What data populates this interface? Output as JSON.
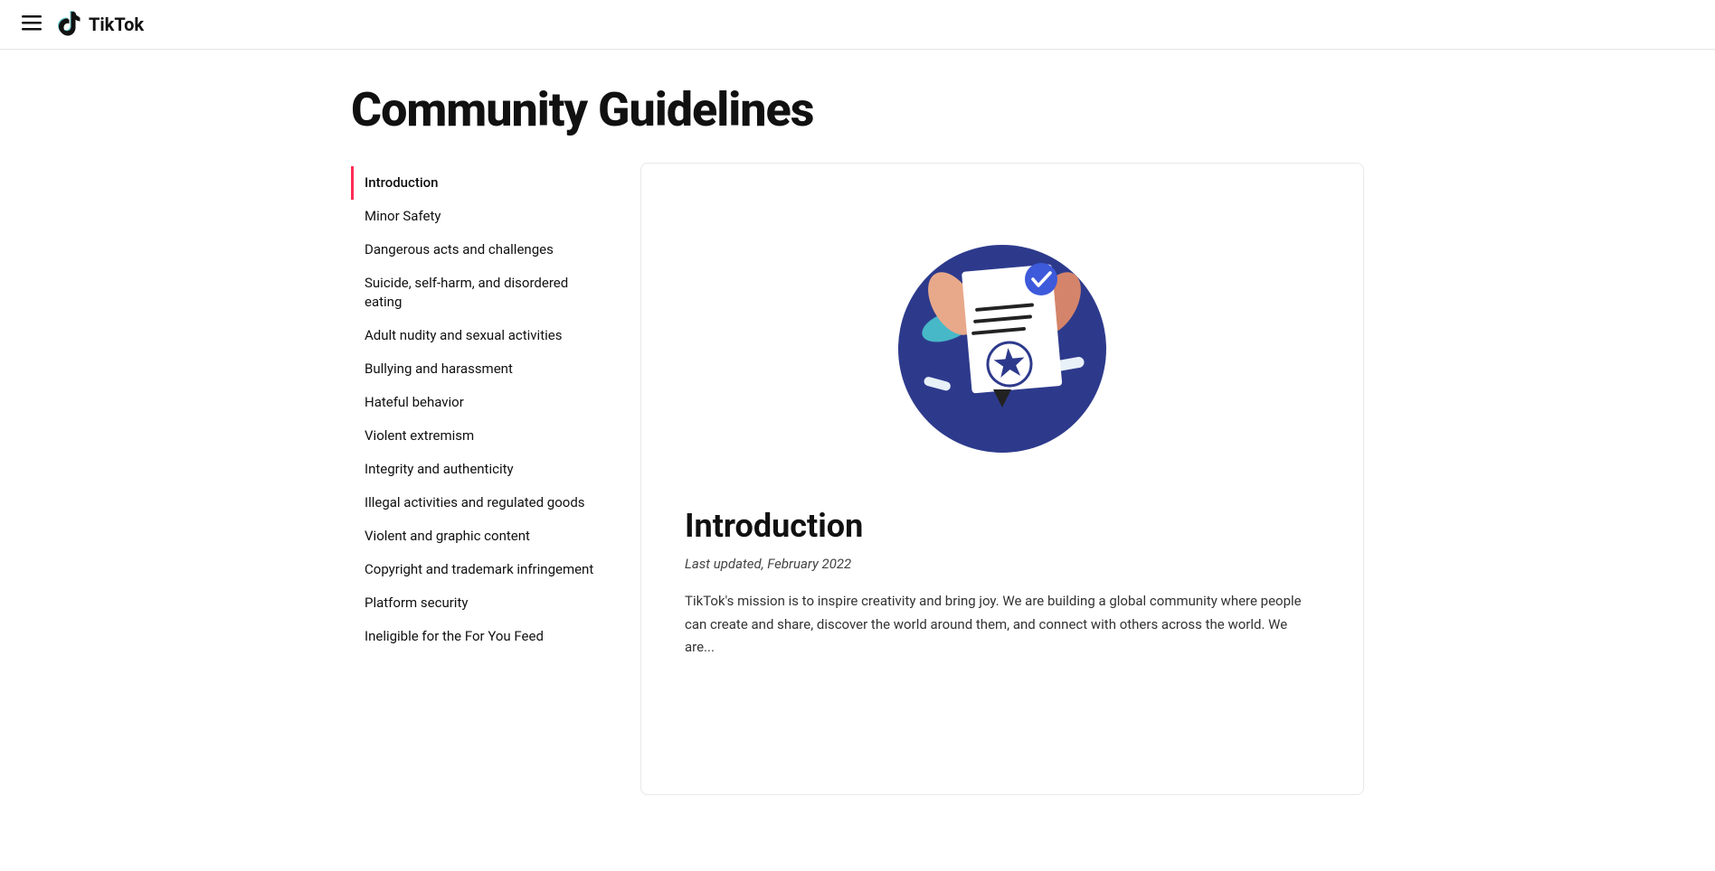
{
  "header": {
    "logo_text": "TikTok",
    "menu_icon": "≡"
  },
  "page": {
    "title": "Community Guidelines"
  },
  "sidebar": {
    "items": [
      {
        "id": "introduction",
        "label": "Introduction",
        "active": true
      },
      {
        "id": "minor-safety",
        "label": "Minor Safety",
        "active": false
      },
      {
        "id": "dangerous-acts",
        "label": "Dangerous acts and challenges",
        "active": false
      },
      {
        "id": "suicide-self-harm",
        "label": "Suicide, self-harm, and disordered eating",
        "active": false
      },
      {
        "id": "adult-nudity",
        "label": "Adult nudity and sexual activities",
        "active": false
      },
      {
        "id": "bullying",
        "label": "Bullying and harassment",
        "active": false
      },
      {
        "id": "hateful-behavior",
        "label": "Hateful behavior",
        "active": false
      },
      {
        "id": "violent-extremism",
        "label": "Violent extremism",
        "active": false
      },
      {
        "id": "integrity",
        "label": "Integrity and authenticity",
        "active": false
      },
      {
        "id": "illegal-activities",
        "label": "Illegal activities and regulated goods",
        "active": false
      },
      {
        "id": "violent-graphic",
        "label": "Violent and graphic content",
        "active": false
      },
      {
        "id": "copyright",
        "label": "Copyright and trademark infringement",
        "active": false
      },
      {
        "id": "platform-security",
        "label": "Platform security",
        "active": false
      },
      {
        "id": "ineligible",
        "label": "Ineligible for the For You Feed",
        "active": false
      }
    ]
  },
  "content": {
    "section_title": "Introduction",
    "last_updated": "Last updated, February 2022",
    "body_text": "TikTok's mission is to inspire creativity and bring joy. We are building a global community where people can create and share, discover the world around them, and connect with others across the world. We are..."
  },
  "colors": {
    "accent": "#fe2c55",
    "active_border": "#fe2c55",
    "dark_blue": "#2d3a8c",
    "mid_blue": "#3d5aa0",
    "light_blue": "#5ba8d4",
    "teal": "#47b8b8",
    "skin": "#e8a98a",
    "dark_skin": "#d4846a"
  }
}
